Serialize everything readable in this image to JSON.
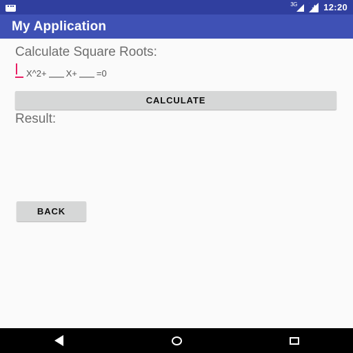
{
  "status_bar": {
    "app_icon": "app-window-icon",
    "network_label": "3G",
    "signal_icon": "signal-bars-icon",
    "sync_icon": "sync-arrows-icon",
    "clock": "12:20",
    "background_color": "#303f9f"
  },
  "app_bar": {
    "title": "My Application",
    "background_color": "#3f51b5",
    "text_color": "#ffffff"
  },
  "main": {
    "heading": "Calculate Square Roots:",
    "equation": {
      "field_a": {
        "value": "",
        "placeholder": "",
        "focused": true,
        "underline_color": "#e91e63"
      },
      "text_after_a": "X^2+",
      "field_b": {
        "value": "",
        "placeholder": "",
        "focused": false,
        "underline_color": "#9e9e9e"
      },
      "text_after_b": "X+",
      "field_c": {
        "value": "",
        "placeholder": "",
        "focused": false,
        "underline_color": "#9e9e9e"
      },
      "text_after_c": "=0"
    },
    "calculate_label": "CALCULATE",
    "result_label": "Result:",
    "result_value": "",
    "back_label": "BACK",
    "button_color": "#d6d7d7",
    "background_color": "#fafafa",
    "heading_color": "#6e6e6e"
  },
  "nav_bar": {
    "background_color": "#000000",
    "buttons": [
      {
        "name": "back",
        "icon": "triangle-back-icon"
      },
      {
        "name": "home",
        "icon": "circle-home-icon"
      },
      {
        "name": "recents",
        "icon": "square-recents-icon"
      }
    ]
  }
}
